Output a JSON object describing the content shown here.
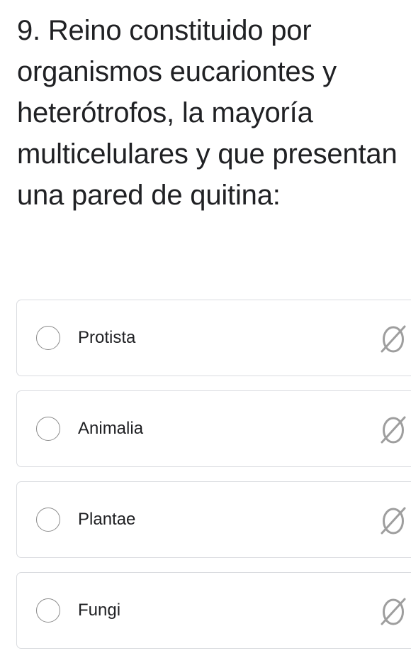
{
  "question": {
    "text": "9. Reino constituido por organismos eucariontes y heterótrofos, la mayoría multicelulares y que presentan una pared de quitina:"
  },
  "options": [
    {
      "label": "Protista",
      "icon": "empty-set-icon"
    },
    {
      "label": "Animalia",
      "icon": "empty-set-icon"
    },
    {
      "label": "Plantae",
      "icon": "empty-set-icon"
    },
    {
      "label": "Fungi",
      "icon": "empty-set-icon"
    }
  ]
}
